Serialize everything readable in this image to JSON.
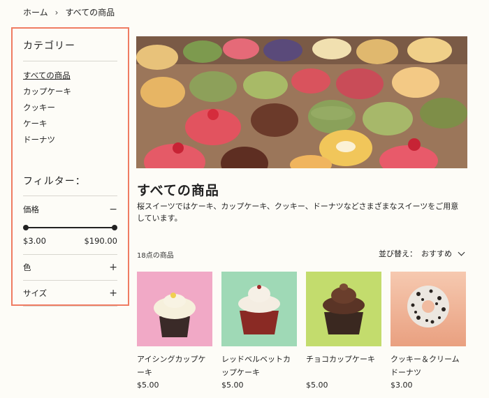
{
  "breadcrumb": {
    "home": "ホーム",
    "current": "すべての商品"
  },
  "sidebar": {
    "category_title": "カテゴリー",
    "categories": [
      {
        "label": "すべての商品"
      },
      {
        "label": "カップケーキ"
      },
      {
        "label": "クッキー"
      },
      {
        "label": "ケーキ"
      },
      {
        "label": "ドーナツ"
      }
    ],
    "filter_title": "フィルター：",
    "price_label": "価格",
    "price_toggle": "−",
    "price_min": "$3.00",
    "price_max": "$190.00",
    "color_label": "色",
    "size_label": "サイズ",
    "expand_symbol": "+"
  },
  "main": {
    "title": "すべての商品",
    "description": "桜スイーツではケーキ、カップケーキ、クッキー、ドーナツなどさまざまなスイーツをご用意しています。",
    "count": "18点の商品",
    "sort_label": "並び替え：",
    "sort_value": "おすすめ"
  },
  "products": [
    {
      "name": "アイシングカップケーキ",
      "price": "$5.00",
      "bg": "#f1a9c6"
    },
    {
      "name": "レッドベルベットカップケーキ",
      "price": "$5.00",
      "bg": "#9fd9b6"
    },
    {
      "name": "チョコカップケーキ",
      "price": "$5.00",
      "bg": "#c3dc6d"
    },
    {
      "name": "クッキー＆クリームドーナツ",
      "price": "$3.00",
      "bg": "#f3b89c"
    }
  ],
  "colors": {
    "accent_border": "#ef7c62",
    "background": "#fdfcf7"
  }
}
